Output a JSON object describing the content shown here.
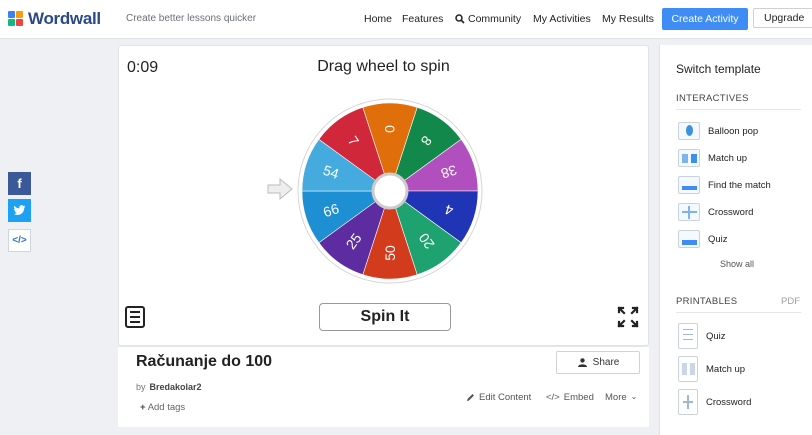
{
  "brand": {
    "name": "Wordwall",
    "tagline": "Create better lessons quicker"
  },
  "nav": {
    "home": "Home",
    "features": "Features",
    "community": "Community",
    "my_activities": "My Activities",
    "my_results": "My Results",
    "create": "Create Activity",
    "upgrade": "Upgrade"
  },
  "social": {
    "facebook": "f",
    "twitter": "t",
    "embed": "</>"
  },
  "game": {
    "timer": "0:09",
    "prompt": "Drag wheel to spin",
    "spin_label": "Spin It",
    "wheel_values": [
      "8",
      "38",
      "4",
      "20",
      "50",
      "25",
      "66",
      "54",
      "7",
      "0"
    ],
    "wheel_colors": [
      "#12894a",
      "#b24fbf",
      "#1f35b5",
      "#1ea26f",
      "#d23b1c",
      "#5d2ca1",
      "#1e8fd2",
      "#45abde",
      "#d0273b",
      "#e06f0b"
    ]
  },
  "activity": {
    "title": "Računanje do 100",
    "by_label": "by",
    "author": "Bredakolar2",
    "add_tags": "Add tags",
    "share": "Share",
    "edit": "Edit Content",
    "embed": "Embed",
    "more": "More"
  },
  "sidebar": {
    "heading": "Switch template",
    "interactives_label": "INTERACTIVES",
    "interactives": [
      "Balloon pop",
      "Match up",
      "Find the match",
      "Crossword",
      "Quiz"
    ],
    "show_all": "Show all",
    "printables_label": "PRINTABLES",
    "pdf_label": "PDF",
    "printables": [
      "Quiz",
      "Match up",
      "Crossword"
    ]
  }
}
